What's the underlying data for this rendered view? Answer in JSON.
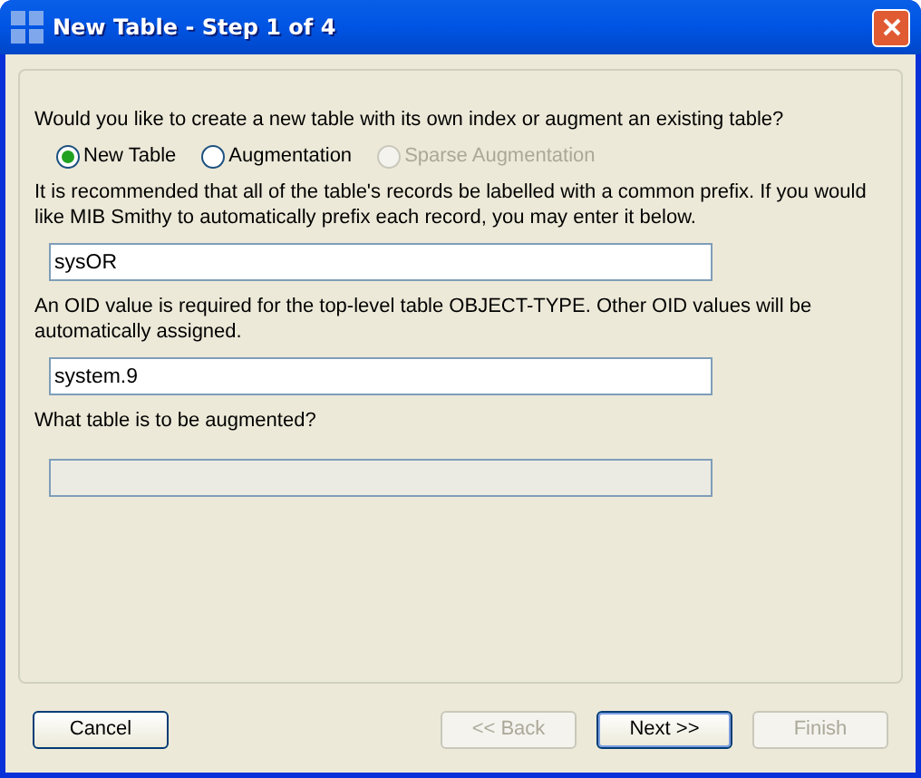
{
  "window": {
    "title": "New Table - Step 1 of 4"
  },
  "sections": [
    {
      "prompt": "Would you like to create a new table with its own index or augment an existing table?",
      "kind": "radios",
      "options": [
        {
          "label": "New Table",
          "selected": true,
          "disabled": false
        },
        {
          "label": "Augmentation",
          "selected": false,
          "disabled": false
        },
        {
          "label": "Sparse Augmentation",
          "selected": false,
          "disabled": true
        }
      ]
    },
    {
      "prompt": "It is recommended that all of the table's records be labelled with a common prefix. If you would like MIB Smithy to automatically prefix each record, you may enter it below.",
      "kind": "field",
      "value": "sysOR",
      "disabled": false
    },
    {
      "prompt": "An OID value is required for the top-level table OBJECT-TYPE. Other OID values will be automatically assigned.",
      "kind": "field",
      "value": "system.9",
      "disabled": false
    },
    {
      "prompt": "What table is to be augmented?",
      "kind": "field",
      "disabled": true
    }
  ],
  "buttons": [
    {
      "label": "Cancel",
      "disabled": false,
      "default": false
    },
    {
      "label": "<< Back",
      "disabled": true,
      "default": false
    },
    {
      "label": "Next >>",
      "disabled": false,
      "default": true
    },
    {
      "label": "Finish",
      "disabled": true,
      "default": false
    }
  ]
}
